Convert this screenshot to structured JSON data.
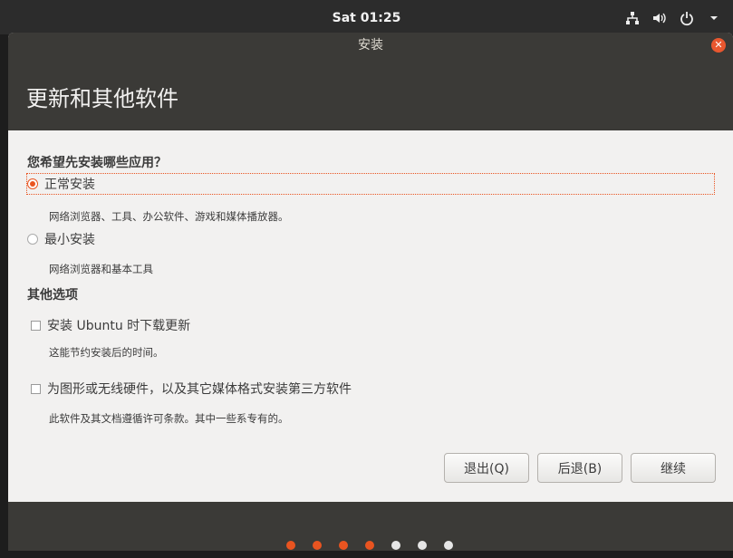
{
  "topbar": {
    "clock": "Sat 01:25",
    "icons": [
      "network-icon",
      "volume-icon",
      "power-icon",
      "menu-caret-icon"
    ]
  },
  "window": {
    "title": "安装",
    "header": "更新和其他软件"
  },
  "content": {
    "question": "您希望先安装哪些应用？",
    "options": [
      {
        "label": "正常安装",
        "desc": "网络浏览器、工具、办公软件、游戏和媒体播放器。",
        "selected": true
      },
      {
        "label": "最小安装",
        "desc": "网络浏览器和基本工具",
        "selected": false
      }
    ],
    "other_title": "其他选项",
    "checks": [
      {
        "label": "安装 Ubuntu 时下载更新",
        "desc": "这能节约安装后的时间。",
        "checked": false
      },
      {
        "label": "为图形或无线硬件，以及其它媒体格式安装第三方软件",
        "desc": "此软件及其文档遵循许可条款。其中一些系专有的。",
        "checked": false
      }
    ]
  },
  "buttons": {
    "quit": "退出(Q)",
    "back": "后退(B)",
    "continue": "继续"
  },
  "progress": {
    "total_steps": 7,
    "completed_steps": 4,
    "active_color": "#e95420",
    "inactive_color": "#e6e6e6"
  }
}
